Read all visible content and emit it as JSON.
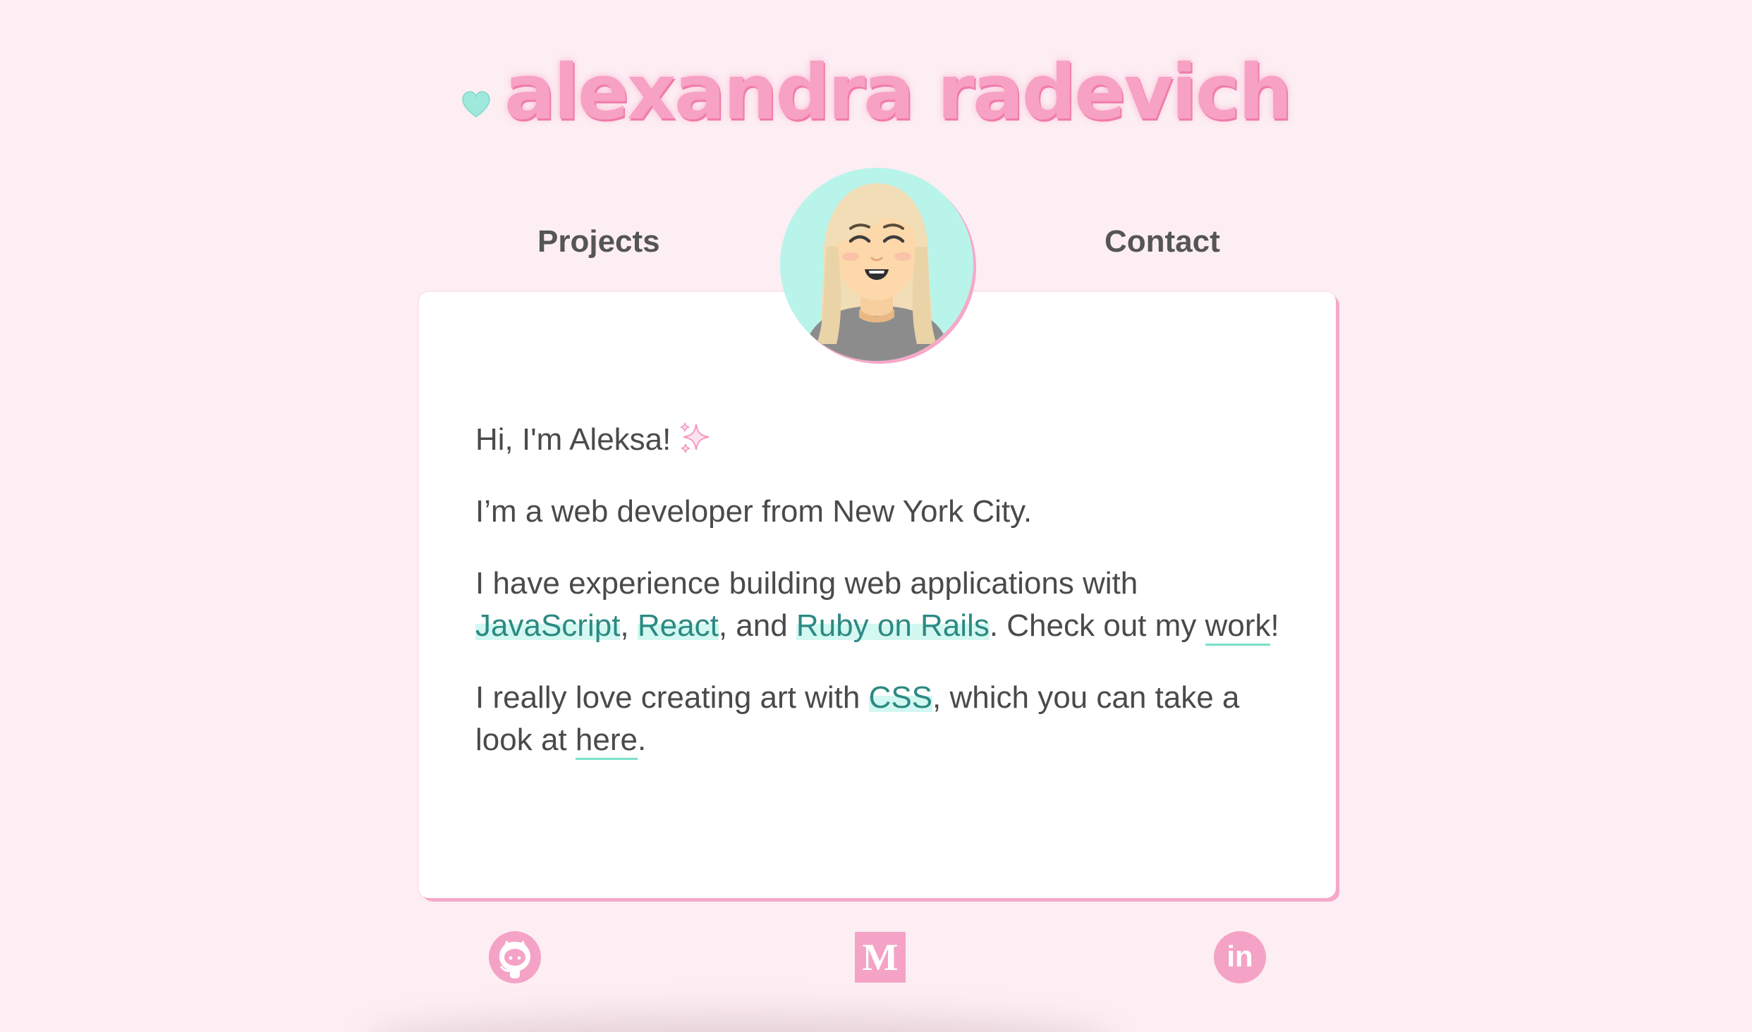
{
  "header": {
    "title": "alexandra radevich",
    "heart_icon": "heart-icon",
    "heart_color": "#9fe9dc",
    "title_color": "#f7a1c4"
  },
  "nav": {
    "projects_label": "Projects",
    "contact_label": "Contact"
  },
  "avatar": {
    "icon": "avatar-illustration"
  },
  "intro": {
    "greeting": "Hi, I'm Aleksa!",
    "sparkle_icon": "sparkle-icon",
    "line_location": "I’m a web developer from New York City.",
    "exp_prefix": "I have experience building web applications with ",
    "tech_js": "JavaScript",
    "sep1": ", ",
    "tech_react": "React",
    "sep2": ", and ",
    "tech_rails": "Ruby on Rails",
    "exp_mid": ". Check out my ",
    "work_link": "work",
    "exp_end": "!",
    "art_prefix": "I really love creating art with ",
    "tech_css": "CSS",
    "art_mid": ", which you can take a look at ",
    "here_link": "here",
    "art_end": "."
  },
  "social": {
    "github_icon": "github-icon",
    "medium_icon": "medium-icon",
    "medium_letter": "M",
    "linkedin_icon": "linkedin-icon",
    "linkedin_text": "in",
    "icon_color": "#f4a3c6"
  },
  "colors": {
    "background": "#fdeef3",
    "accent_pink": "#f6a8c8",
    "highlight_mint": "#d2f8f1",
    "highlight_text": "#2c8a83",
    "underline_mint": "#7be0c9"
  }
}
